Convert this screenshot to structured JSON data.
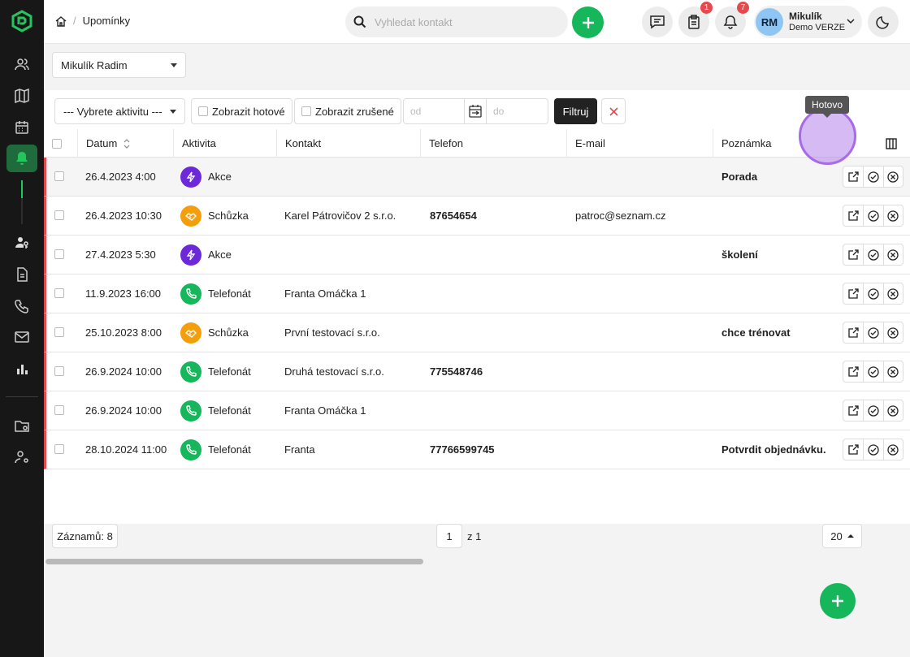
{
  "breadcrumb": {
    "page": "Upomínky"
  },
  "search": {
    "placeholder": "Vyhledat kontakt"
  },
  "badges": {
    "tasks": "1",
    "notifications": "7"
  },
  "user": {
    "initials": "RM",
    "name": "Mikulík",
    "subtitle": "Demo VERZE"
  },
  "user_select": {
    "value": "Mikulík Radim"
  },
  "filters": {
    "activity_placeholder": "--- Vybrete aktivitu ---",
    "show_done": "Zobrazit hotové",
    "show_cancelled": "Zobrazit zrušené",
    "date_from_placeholder": "od",
    "date_to_placeholder": "do",
    "filter_button": "Filtruj"
  },
  "table": {
    "columns": [
      "Datum",
      "Aktivita",
      "Kontakt",
      "Telefon",
      "E-mail",
      "Poznámka"
    ],
    "rows": [
      {
        "date": "26.4.2023 4:00",
        "activity": "Akce",
        "type": "akce",
        "contact": "",
        "phone": "",
        "email": "",
        "note": "Porada"
      },
      {
        "date": "26.4.2023 10:30",
        "activity": "Schůzka",
        "type": "schuzka",
        "contact": "Karel Pátrovičov 2 s.r.o.",
        "phone": "87654654",
        "email": "patroc@seznam.cz",
        "note": ""
      },
      {
        "date": "27.4.2023 5:30",
        "activity": "Akce",
        "type": "akce",
        "contact": "",
        "phone": "",
        "email": "",
        "note": "školení"
      },
      {
        "date": "11.9.2023 16:00",
        "activity": "Telefonát",
        "type": "telefonat",
        "contact": "Franta Omáčka 1",
        "phone": "",
        "email": "",
        "note": ""
      },
      {
        "date": "25.10.2023 8:00",
        "activity": "Schůzka",
        "type": "schuzka",
        "contact": "První testovací s.r.o.",
        "phone": "",
        "email": "",
        "note": "chce trénovat"
      },
      {
        "date": "26.9.2024 10:00",
        "activity": "Telefonát",
        "type": "telefonat",
        "contact": "Druhá testovací s.r.o.",
        "phone": "775548746",
        "email": "",
        "note": ""
      },
      {
        "date": "26.9.2024 10:00",
        "activity": "Telefonát",
        "type": "telefonat",
        "contact": "Franta Omáčka 1",
        "phone": "",
        "email": "",
        "note": ""
      },
      {
        "date": "28.10.2024 11:00",
        "activity": "Telefonát",
        "type": "telefonat",
        "contact": "Franta",
        "phone": "77766599745",
        "email": "",
        "note": "Potvrdit objednávku."
      }
    ]
  },
  "tooltip": {
    "text": "Hotovo"
  },
  "pagination": {
    "records": "Záznamů: 8",
    "page": "1",
    "of": "z 1",
    "per_page": "20"
  },
  "colors": {
    "akce": "#6d28d9",
    "schuzka": "#f59e0b",
    "telefonat": "#16b65a",
    "accent": "#16b65a",
    "row_marker": "#e5484d"
  },
  "icons": {
    "sidebar": [
      "contacts-icon",
      "map-icon",
      "calendar-icon",
      "bell-icon",
      "person-key-icon",
      "document-icon",
      "phone-icon",
      "mail-icon",
      "chart-icon",
      "folder-settings-icon",
      "user-settings-icon"
    ],
    "header": [
      "home-icon",
      "search-icon",
      "plus-icon",
      "chat-icon",
      "clipboard-icon",
      "bell-icon",
      "chevron-down-icon",
      "moon-icon"
    ]
  }
}
